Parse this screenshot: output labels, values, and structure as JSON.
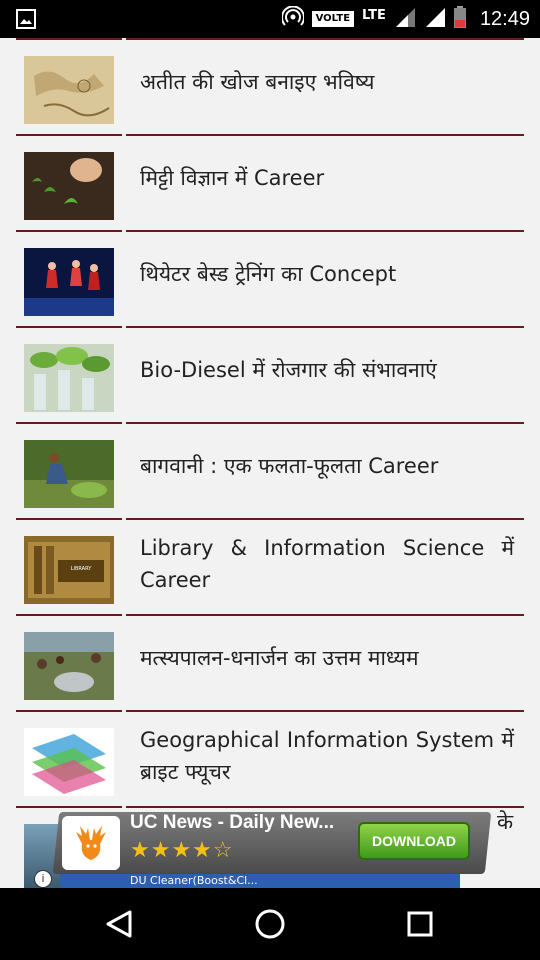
{
  "status_bar": {
    "time": "12:49",
    "network_label": "LTE",
    "volte_label": "VOLTE",
    "icons": [
      "image-notification-icon",
      "hotspot-icon",
      "signal-icon",
      "battery-icon"
    ]
  },
  "articles": [
    {
      "title": "अतीत की खोज बनाइए भविष्य",
      "thumb": "map-thumbnail"
    },
    {
      "title": "मिट्टी विज्ञान में Career",
      "thumb": "soil-thumbnail"
    },
    {
      "title": "थियेटर बेस्ड ट्रेनिंग का Concept",
      "thumb": "theatre-thumbnail"
    },
    {
      "title": "Bio-Diesel में रोजगार की संभावनाएं",
      "thumb": "plants-thumbnail"
    },
    {
      "title": "बागवानी : एक फलता-फूलता Career",
      "thumb": "gardening-thumbnail"
    },
    {
      "title": "Library & Information Science में Career",
      "thumb": "library-thumbnail"
    },
    {
      "title": "मत्स्यपालन-धनार्जन का उत्तम माध्यम",
      "thumb": "fishery-thumbnail"
    },
    {
      "title": "Geographical Information System में ब्राइट फ्यूचर",
      "thumb": "gis-thumbnail"
    }
  ],
  "partial_item_text": "के",
  "ad": {
    "title": "UC News - Daily New...",
    "rating_stars": "★★★★☆",
    "button_label": "DOWNLOAD",
    "sub_text": "DU Cleaner(Boost&Cl...",
    "info_label": "i"
  },
  "colors": {
    "divider": "#6b1a1a",
    "background": "#f2f2f2"
  }
}
